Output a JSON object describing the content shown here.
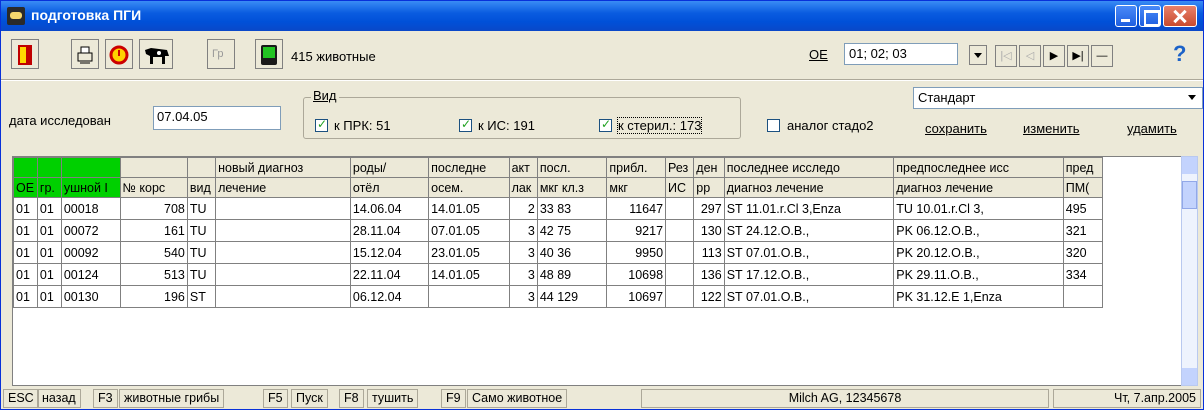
{
  "window": {
    "title": "подготовка ПГИ"
  },
  "toolbar": {
    "gr_label": "Гр",
    "animals_count": "415 животные",
    "oe_label": "ОЕ",
    "oe_value": "01; 02; 03"
  },
  "filters": {
    "date_label": "дата исследован",
    "date_value": "07.04.05",
    "vid_title": "Вид",
    "chk_prk": "к ПРК: 51",
    "chk_is": "к ИС: 191",
    "chk_steril": "к стерил.: 173",
    "analog_label": "аналог стадо2",
    "standard_value": "Стандарт",
    "save_label": "сохранить",
    "edit_label": "изменить",
    "delete_label": "удамить"
  },
  "table": {
    "headers_top": [
      "",
      "",
      "",
      "",
      "",
      "новый диагноз",
      "роды/",
      "последне",
      "акт",
      "посл.",
      "прибл.",
      "Рез",
      "ден",
      "последнее исследо",
      "предпоследнее исс",
      "пред"
    ],
    "headers_bottom": [
      "ОЕ",
      "гр.",
      "ушной I",
      "№ корс",
      "вид",
      "лечение",
      "отёл",
      "осем.",
      "лак",
      "мкг кл.з",
      "мкг",
      "ИС",
      "рр",
      "диагноз лечение",
      "диагноз лечение",
      "ПМ("
    ],
    "rows": [
      [
        "01",
        "01",
        "00018",
        "708",
        "TU",
        "",
        "14.06.04",
        "14.01.05",
        "2",
        "33   83",
        "11647",
        "",
        "297",
        "ST 11.01.r.Cl 3,Enza",
        "TU 10.01.r.Cl 3,",
        "495"
      ],
      [
        "01",
        "01",
        "00072",
        "161",
        "TU",
        "",
        "28.11.04",
        "07.01.05",
        "3",
        "42   75",
        "9217",
        "",
        "130",
        "ST 24.12.O.B.,",
        "PK 06.12.O.B.,",
        "321"
      ],
      [
        "01",
        "01",
        "00092",
        "540",
        "TU",
        "",
        "15.12.04",
        "23.01.05",
        "3",
        "40   36",
        "9950",
        "",
        "113",
        "ST 07.01.O.B.,",
        "PK 20.12.O.B.,",
        "320"
      ],
      [
        "01",
        "01",
        "00124",
        "513",
        "TU",
        "",
        "22.11.04",
        "14.01.05",
        "3",
        "48   89",
        "10698",
        "",
        "136",
        "ST 17.12.O.B.,",
        "PK 29.11.O.B.,",
        "334"
      ],
      [
        "01",
        "01",
        "00130",
        "196",
        "ST",
        "",
        "06.12.04",
        "",
        "3",
        "44  129",
        "10697",
        "",
        "122",
        "ST 07.01.O.B.,",
        "PK 31.12.E 1,Enza",
        ""
      ]
    ]
  },
  "status": {
    "esc": "ESC",
    "back": "назад",
    "f3": "F3",
    "f3_label": "животные грибы",
    "f5": "F5",
    "f5_label": "Пуск",
    "f8": "F8",
    "f8_label": "тушить",
    "f9": "F9",
    "f9_label": "Само животное",
    "company": "Milch AG, 12345678",
    "date": "Чт, 7.апр.2005"
  }
}
